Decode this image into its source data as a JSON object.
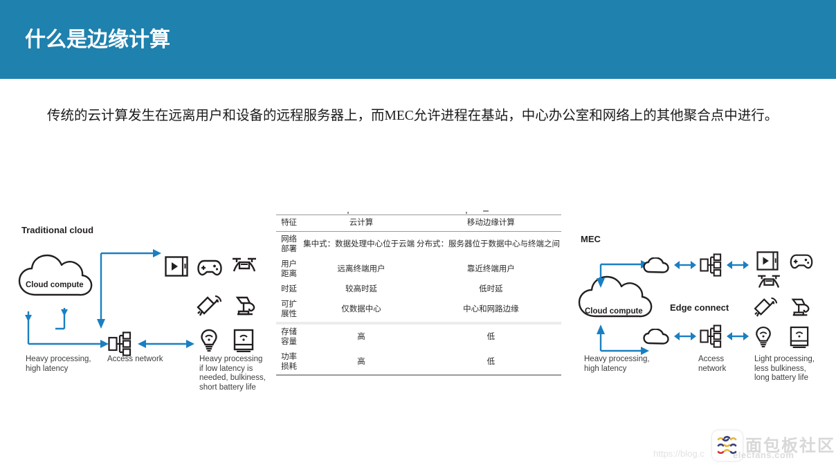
{
  "header": {
    "title": "什么是边缘计算",
    "bar_color": "#1f81ad"
  },
  "body": {
    "paragraph": "传统的云计算发生在远离用户和设备的远程服务器上，而MEC允许进程在基站，中心办公室和网络上的其他聚合点中进行。"
  },
  "accent": {
    "arrow_blue": "#1a7fc1",
    "icon_black": "#231f20"
  },
  "left_diagram": {
    "title": "Traditional cloud",
    "cloud_label": "Cloud compute",
    "labels": {
      "cloud": "Heavy processing,\nhigh latency",
      "network": "Access network",
      "devices": "Heavy processing\nif low latency is\nneeded, bulkiness,\nshort battery life"
    },
    "icons": [
      "video-tablet-icon",
      "game-controller-icon",
      "drone-icon",
      "security-camera-icon",
      "robot-arm-icon",
      "smart-bulb-icon",
      "smart-appliance-icon",
      "access-network-icon",
      "cloud-icon"
    ]
  },
  "right_diagram": {
    "title": "MEC",
    "cloud_label": "Cloud compute",
    "middle_label": "Edge connect",
    "labels": {
      "cloud": "Heavy processing,\nhigh latency",
      "network": "Access\nnetwork",
      "devices": "Light processing,\nless bulkiness,\nlong battery life"
    },
    "icons": [
      "cloud-icon",
      "access-network-icon",
      "video-tablet-icon",
      "game-controller-icon",
      "drone-icon",
      "security-camera-icon",
      "robot-arm-icon",
      "smart-bulb-icon",
      "smart-appliance-icon"
    ]
  },
  "table": {
    "headers": [
      "特征",
      "云计算",
      "移动边缘计算"
    ],
    "rows": [
      {
        "feature": "网络部署",
        "merged": "集中式：数据处理中心位于云端  分布式：服务器位于数据中心与终端之间"
      },
      {
        "feature": "用户距离",
        "cloud": "远离终端用户",
        "mec": "靠近终端用户"
      },
      {
        "feature": "时延",
        "cloud": "较高时延",
        "mec": "低时延"
      },
      {
        "feature": "可扩展性",
        "cloud": "仅数据中心",
        "mec": "中心和网路边缘"
      },
      {
        "feature": "存储容量",
        "cloud": "高",
        "mec": "低",
        "band_top": true
      },
      {
        "feature": "功率损耗",
        "cloud": "高",
        "mec": "低"
      }
    ]
  },
  "watermark": {
    "cn_text": "面包板社区",
    "en_text": "elecfans.com",
    "url_text": "https://blog.c"
  }
}
